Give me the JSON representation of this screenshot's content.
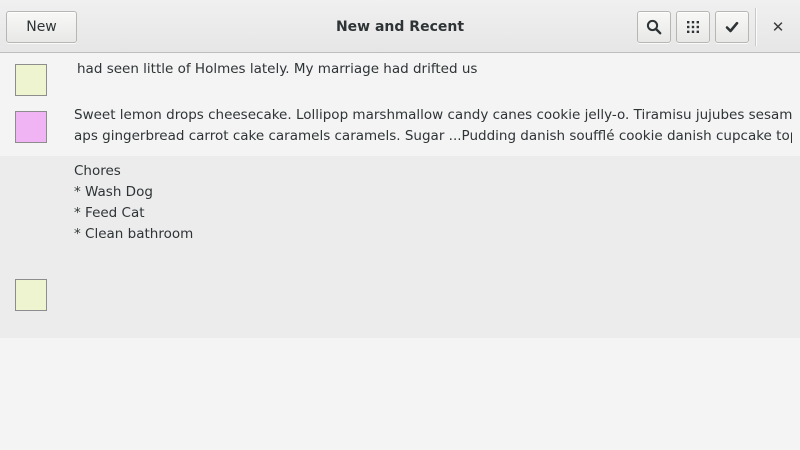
{
  "window": {
    "title": "New and Recent"
  },
  "toolbar": {
    "new_label": "New",
    "search_icon": "search-icon",
    "grid_icon": "view-grid-icon",
    "select_icon": "checkmark-icon",
    "close_symbol": "✕"
  },
  "notes": [
    {
      "text": "had seen little of Holmes lately. My marriage had drifted us",
      "color": "#eff4d0"
    },
    {
      "text": "Sweet lemon drops cheesecake. Lollipop marshmallow candy canes cookie jelly-o. Tiramisu jujubes sesame sn\naps gingerbread carrot cake caramels caramels. Sugar ...Pudding danish soufflé cookie danish cupcake topping.",
      "color": "#f0b4f4"
    },
    {
      "text": "Chores\n* Wash Dog\n* Feed Cat\n* Clean bathroom",
      "color": "#eff4d0"
    }
  ]
}
